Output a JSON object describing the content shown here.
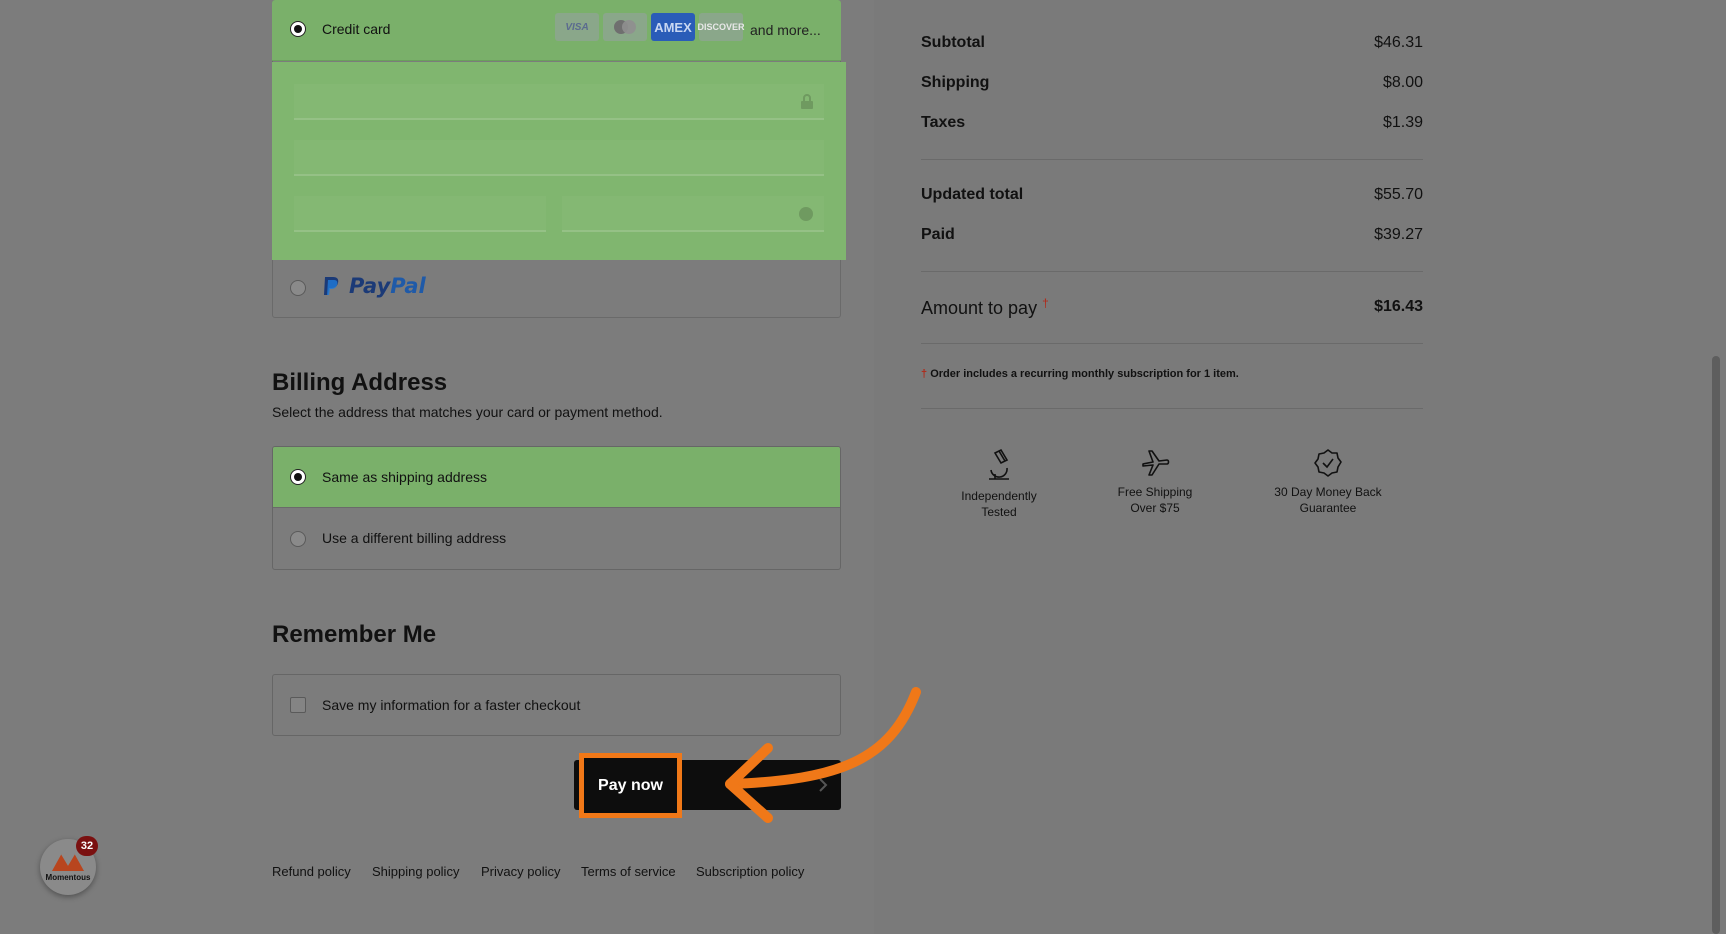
{
  "payment": {
    "credit_card_label": "Credit card",
    "card_logos": [
      "VISA",
      "Mastercard",
      "AMEX",
      "DISCOVER"
    ],
    "and_more": "and more...",
    "paypal_label_pay": "Pay",
    "paypal_label_pal": "Pal"
  },
  "billing": {
    "title": "Billing Address",
    "subtitle": "Select the address that matches your card or payment method.",
    "same_label": "Same as shipping address",
    "different_label": "Use a different billing address"
  },
  "remember": {
    "title": "Remember Me",
    "save_label": "Save my information for a faster checkout"
  },
  "pay_now": "Pay now",
  "footer": [
    "Refund policy",
    "Shipping policy",
    "Privacy policy",
    "Terms of service",
    "Subscription policy"
  ],
  "badge": {
    "count": "32",
    "name": "Momentous"
  },
  "summary": {
    "subtotal_label": "Subtotal",
    "subtotal": "$46.31",
    "shipping_label": "Shipping",
    "shipping": "$8.00",
    "taxes_label": "Taxes",
    "taxes": "$1.39",
    "updated_total_label": "Updated total",
    "updated_total": "$55.70",
    "paid_label": "Paid",
    "paid": "$39.27",
    "amount_label": "Amount to pay",
    "amount_dagger": "†",
    "amount": "$16.43",
    "note_dagger": "†",
    "note": "Order includes a recurring monthly subscription for 1 item."
  },
  "trust": {
    "tested_1": "Independently",
    "tested_2": "Tested",
    "shipping_1": "Free Shipping",
    "shipping_2": "Over $75",
    "guarantee_1": "30 Day Money Back",
    "guarantee_2": "Guarantee"
  },
  "colors": {
    "selected_green": "#7ab06a",
    "annotation_orange": "#f07818",
    "paypal_blue": "#1b3a77"
  }
}
